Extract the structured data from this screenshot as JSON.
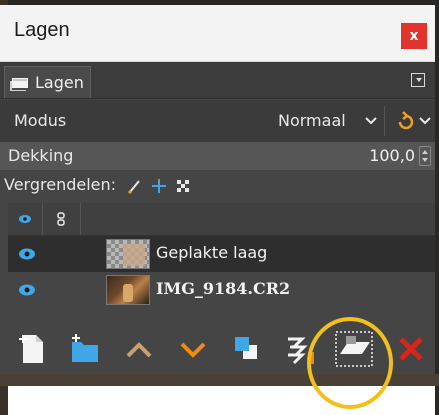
{
  "window": {
    "title": "Lagen",
    "close_glyph": "x"
  },
  "tab": {
    "label": "Lagen",
    "icon": "layers-stack-icon"
  },
  "mode": {
    "label": "Modus",
    "value": "Normaal"
  },
  "opacity": {
    "label": "Dekking",
    "value": "100,0"
  },
  "lock": {
    "label": "Vergrendelen:",
    "icons": [
      "lock-pixels-icon",
      "lock-position-icon",
      "lock-alpha-icon"
    ]
  },
  "layers": [
    {
      "name": "Geplakte laag",
      "visible": true,
      "selected": true,
      "thumbnail": "transparent-checker"
    },
    {
      "name": "IMG_9184.CR2",
      "visible": true,
      "selected": false,
      "thumbnail": "photo"
    }
  ],
  "toolbar": [
    "new-layer-icon",
    "new-layer-group-icon",
    "raise-layer-icon",
    "lower-layer-icon",
    "duplicate-layer-icon",
    "merge-layer-icon",
    "anchor-layer-icon",
    "delete-layer-icon"
  ],
  "colors": {
    "dock_bg": "#454545",
    "selected_row": "#2e2e2e",
    "accent_orange": "#f08a10",
    "eye_blue": "#3fa7e8",
    "close_red": "#e0342c",
    "delete_red": "#d9241c",
    "highlight_ring": "#f2c01a"
  }
}
